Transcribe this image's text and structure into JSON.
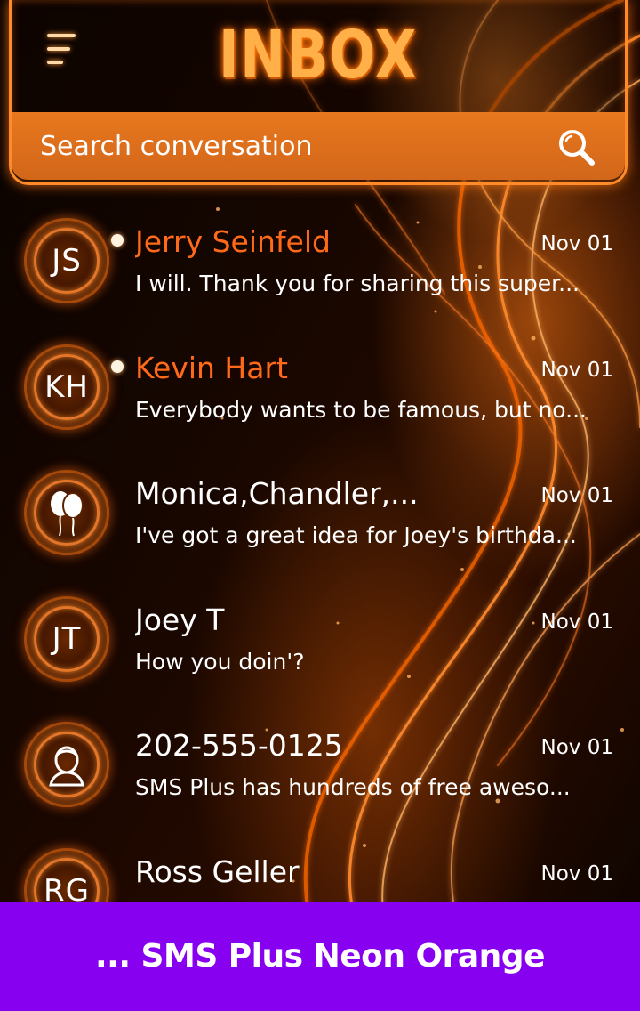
{
  "header": {
    "title": "INBOX",
    "search_placeholder": "Search conversation"
  },
  "conversations": [
    {
      "avatar": "JS",
      "avatar_type": "initials",
      "name": "Jerry Seinfeld",
      "unread": true,
      "date": "Nov 01",
      "preview": "I will. Thank you for sharing this super..."
    },
    {
      "avatar": "KH",
      "avatar_type": "initials",
      "name": "Kevin Hart",
      "unread": true,
      "date": "Nov 01",
      "preview": "Everybody wants to be famous, but no..."
    },
    {
      "avatar": "balloons-icon",
      "avatar_type": "icon",
      "name": "Monica,Chandler,...",
      "unread": false,
      "date": "Nov 01",
      "preview": "I've got a great idea for Joey's birthda..."
    },
    {
      "avatar": "JT",
      "avatar_type": "initials",
      "name": "Joey T",
      "unread": false,
      "date": "Nov 01",
      "preview": "How you doin'?"
    },
    {
      "avatar": "person-icon",
      "avatar_type": "icon",
      "name": "202-555-0125",
      "unread": false,
      "date": "Nov 01",
      "preview": "SMS Plus has hundreds of free aweso..."
    },
    {
      "avatar": "RG",
      "avatar_type": "initials",
      "name": "Ross Geller",
      "unread": false,
      "date": "Nov 01",
      "preview": ""
    }
  ],
  "banner": {
    "text": "... SMS Plus Neon Orange"
  },
  "colors": {
    "accent": "#ff6a1a",
    "search_bar": "#e0701c",
    "banner": "#8800f0"
  }
}
